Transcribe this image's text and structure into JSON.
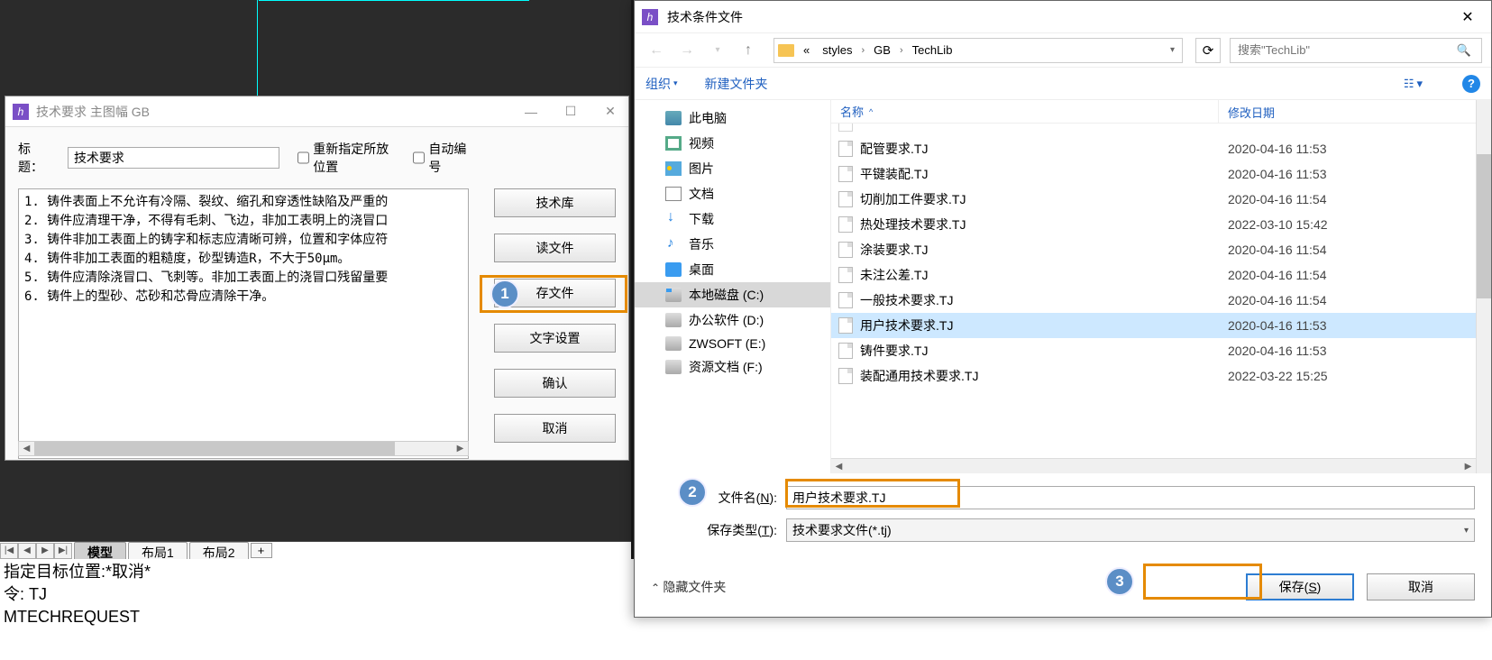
{
  "leftDialog": {
    "title": "技术要求 主图幅 GB",
    "titleLabel": "标题：",
    "titleValue": "技术要求",
    "reposition": "重新指定所放位置",
    "autoNumber": "自动编号",
    "lines": "1. 铸件表面上不允许有冷隔、裂纹、缩孔和穿透性缺陷及严重的\n2. 铸件应清理干净，不得有毛刺、飞边，非加工表明上的浇冒口\n3. 铸件非加工表面上的铸字和标志应清晰可辨，位置和字体应符\n4. 铸件非加工表面的粗糙度，砂型铸造R，不大于50μm。\n5. 铸件应清除浇冒口、飞刺等。非加工表面上的浇冒口残留量要\n6. 铸件上的型砂、芯砂和芯骨应清除干净。",
    "buttons": {
      "techLib": "技术库",
      "readFile": "读文件",
      "saveFile": "存文件",
      "textSettings": "文字设置",
      "ok": "确认",
      "cancel": "取消"
    }
  },
  "tabs": {
    "model": "模型",
    "layout1": "布局1",
    "layout2": "布局2",
    "plus": "+"
  },
  "cmd": {
    "line1": "指定目标位置:*取消*",
    "line2": "令: TJ",
    "line3": "MTECHREQUEST"
  },
  "saveDialog": {
    "title": "技术条件文件",
    "crumbPrefix": "«",
    "crumb1": "styles",
    "crumb2": "GB",
    "crumb3": "TechLib",
    "searchPlaceholder": "搜索\"TechLib\"",
    "organize": "组织",
    "newFolder": "新建文件夹",
    "cols": {
      "name": "名称",
      "date": "修改日期"
    },
    "tree": {
      "pc": "此电脑",
      "video": "视频",
      "pic": "图片",
      "doc": "文档",
      "down": "下载",
      "music": "音乐",
      "desk": "桌面",
      "c": "本地磁盘 (C:)",
      "d": "办公软件 (D:)",
      "e": "ZWSOFT (E:)",
      "f": "资源文档 (F:)"
    },
    "files": [
      {
        "name": "配管要求.TJ",
        "date": "2020-04-16 11:53"
      },
      {
        "name": "平键装配.TJ",
        "date": "2020-04-16 11:53"
      },
      {
        "name": "切削加工件要求.TJ",
        "date": "2020-04-16 11:54"
      },
      {
        "name": "热处理技术要求.TJ",
        "date": "2022-03-10 15:42"
      },
      {
        "name": "涂装要求.TJ",
        "date": "2020-04-16 11:54"
      },
      {
        "name": "未注公差.TJ",
        "date": "2020-04-16 11:54"
      },
      {
        "name": "一般技术要求.TJ",
        "date": "2020-04-16 11:54"
      },
      {
        "name": "用户技术要求.TJ",
        "date": "2020-04-16 11:53",
        "selected": true
      },
      {
        "name": "铸件要求.TJ",
        "date": "2020-04-16 11:53"
      },
      {
        "name": "装配通用技术要求.TJ",
        "date": "2022-03-22 15:25"
      }
    ],
    "fileNameLabel": "文件名(N):",
    "fileNameValue": "用户技术要求.TJ",
    "fileTypeLabel": "保存类型(T):",
    "fileTypeValue": "技术要求文件(*.tj)",
    "hideFolders": "隐藏文件夹",
    "saveBtn": "保存(S)",
    "cancelBtn": "取消"
  },
  "callouts": {
    "1": "1",
    "2": "2",
    "3": "3"
  }
}
